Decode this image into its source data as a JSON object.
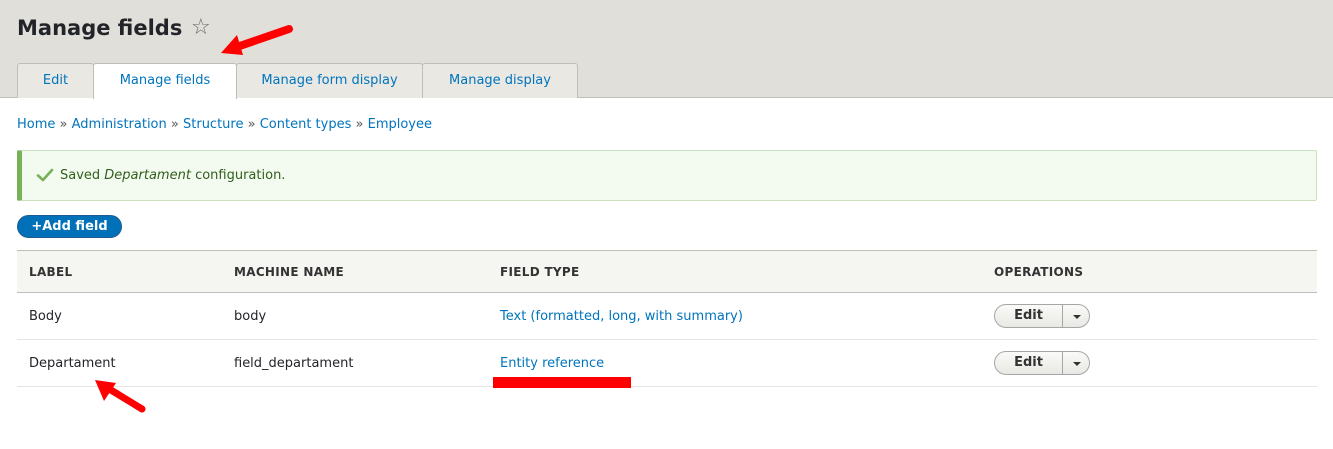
{
  "header": {
    "title": "Manage fields",
    "star_icon": "☆"
  },
  "tabs": [
    {
      "label": "Edit",
      "active": false
    },
    {
      "label": "Manage fields",
      "active": true
    },
    {
      "label": "Manage form display",
      "active": false
    },
    {
      "label": "Manage display",
      "active": false
    }
  ],
  "breadcrumb": [
    "Home",
    "Administration",
    "Structure",
    "Content types",
    "Employee"
  ],
  "breadcrumb_sep": "»",
  "message": {
    "prefix": "Saved ",
    "emphasis": "Departament",
    "suffix": " configuration.",
    "icon": "check-icon"
  },
  "add_field": {
    "label": "Add field",
    "icon": "+"
  },
  "table": {
    "headers": [
      "LABEL",
      "MACHINE NAME",
      "FIELD TYPE",
      "OPERATIONS"
    ],
    "rows": [
      {
        "label": "Body",
        "machine_name": "body",
        "field_type": "Text (formatted, long, with summary)",
        "op": "Edit"
      },
      {
        "label": "Departament",
        "machine_name": "field_departament",
        "field_type": "Entity reference",
        "op": "Edit"
      }
    ]
  },
  "colors": {
    "link": "#0074bd",
    "button": "#0071b8",
    "annotation": "#ff0000",
    "success_border": "#77b259"
  }
}
